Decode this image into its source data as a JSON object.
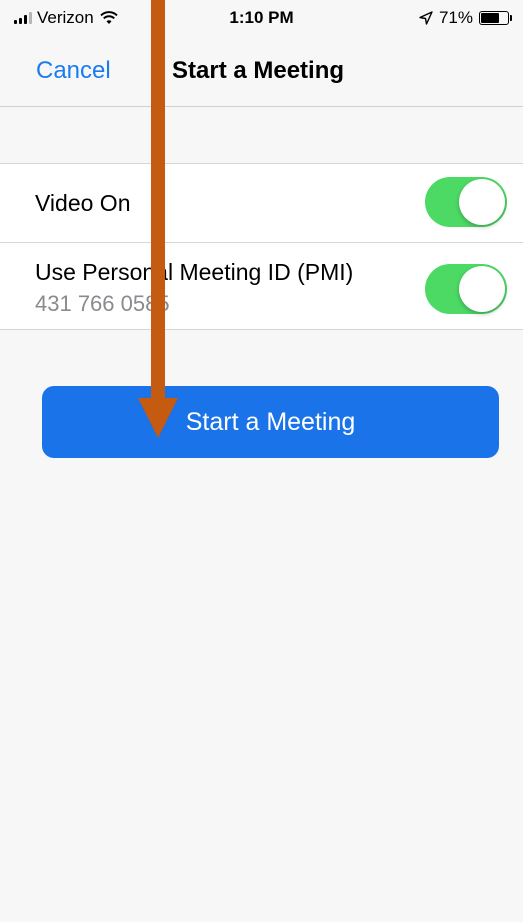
{
  "status_bar": {
    "carrier": "Verizon",
    "time": "1:10 PM",
    "battery_percent": "71%",
    "battery_level": 0.71,
    "icons": [
      "signal-icon",
      "wifi-icon",
      "location-icon",
      "battery-icon"
    ]
  },
  "nav": {
    "cancel_label": "Cancel",
    "title": "Start a Meeting"
  },
  "settings": {
    "video_on": {
      "label": "Video On",
      "enabled": true
    },
    "pmi": {
      "label": "Use Personal Meeting ID (PMI)",
      "id": "431 766 0585",
      "enabled": true
    }
  },
  "start_button": {
    "label": "Start a Meeting"
  },
  "colors": {
    "accent": "#1a7cf0",
    "button": "#1a73e8",
    "toggle_on": "#4cd964",
    "annotation_arrow": "#c55a11"
  }
}
